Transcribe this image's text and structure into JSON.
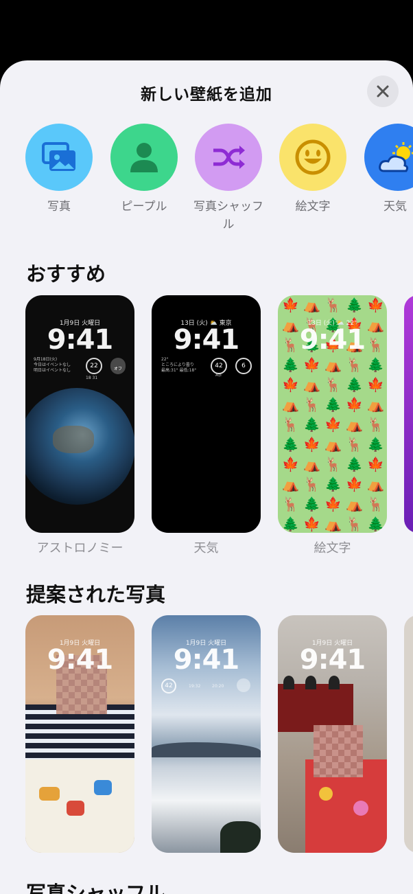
{
  "sheet": {
    "title": "新しい壁紙を追加"
  },
  "categories": [
    {
      "label": "写真",
      "icon": "photos-icon",
      "color": "#5ac8fa"
    },
    {
      "label": "ピープル",
      "icon": "person-icon",
      "color": "#34c759"
    },
    {
      "label": "写真シャッフル",
      "icon": "shuffle-icon",
      "color": "#bf5af2"
    },
    {
      "label": "絵文字",
      "icon": "smiley-icon",
      "color": "#ffd60a"
    },
    {
      "label": "天気",
      "icon": "weather-icon",
      "color": "#0a84ff"
    }
  ],
  "recommended": {
    "title": "おすすめ",
    "cards": [
      {
        "label": "アストロノミー",
        "date": "1月9日 火曜日",
        "time": "9:41",
        "event_date": "9月18日(火)",
        "event_line1": "今日はイベントなし",
        "event_line2": "明日はイベントなし",
        "ring_value": "22",
        "ring_sub": "18 31",
        "toggle": "オフ"
      },
      {
        "label": "天気",
        "date": "13日 (火)  ⛅ 東京",
        "time": "9:41",
        "temp": "22°",
        "weather_line1": "ところにより曇り",
        "weather_line2": "最高:31° 最低:18°",
        "aqi": "42",
        "aqi_label": "AQI",
        "uv": "6"
      },
      {
        "label": "絵文字",
        "date": "13日 (火)  ⛅ 22°",
        "time": "9:41"
      }
    ]
  },
  "suggested": {
    "title": "提案された写真",
    "cards": [
      {
        "date": "1月9日 火曜日",
        "time": "9:41"
      },
      {
        "date": "1月9日 火曜日",
        "time": "9:41",
        "ring": "42",
        "t1": "19:32",
        "t2": "20:20"
      },
      {
        "date": "1月9日 火曜日",
        "time": "9:41"
      }
    ]
  },
  "next_section": {
    "title": "写真シャッフル"
  }
}
